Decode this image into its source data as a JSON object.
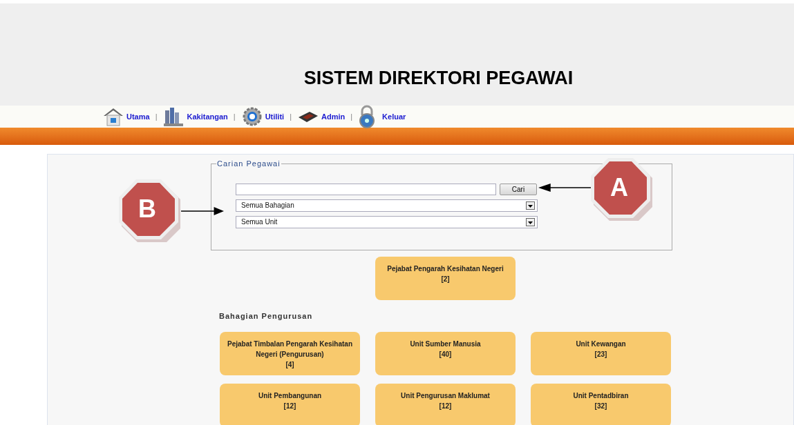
{
  "header": {
    "title": "SISTEM DIREKTORI PEGAWAI"
  },
  "nav": [
    {
      "label": "Utama"
    },
    {
      "label": "Kakitangan"
    },
    {
      "label": "Utiliti"
    },
    {
      "label": "Admin"
    },
    {
      "label": "Keluar"
    }
  ],
  "nav_separator": "|",
  "search": {
    "legend": "Carian Pegawai",
    "button": "Cari",
    "selects": [
      {
        "value": "Semua Bahagian"
      },
      {
        "value": "Semua Unit"
      }
    ]
  },
  "top_card": {
    "title": "Pejabat Pengarah Kesihatan Negeri",
    "count": "[2]"
  },
  "section": {
    "heading": "Bahagian Pengurusan",
    "cards": [
      {
        "title": "Pejabat Timbalan Pengarah Kesihatan Negeri (Pengurusan)",
        "count": "[4]"
      },
      {
        "title": "Unit Sumber Manusia",
        "count": "[40]"
      },
      {
        "title": "Unit Kewangan",
        "count": "[23]"
      },
      {
        "title": "Unit Pembangunan",
        "count": "[12]"
      },
      {
        "title": "Unit Pengurusan Maklumat",
        "count": "[12]"
      },
      {
        "title": "Unit Pentadbiran",
        "count": "[32]"
      }
    ]
  },
  "callouts": [
    {
      "label": "A"
    },
    {
      "label": "B"
    }
  ]
}
